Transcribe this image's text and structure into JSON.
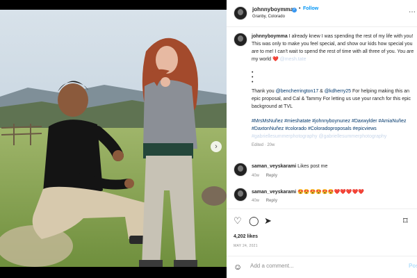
{
  "post": {
    "username": "johnnyboymma",
    "location": "Granby, Colorado",
    "follow_label": "Follow",
    "more_icon": "ellipsis-icon"
  },
  "caption": {
    "username": "johnnyboymma",
    "text_1": "I already knew I was spending the rest of my life with you! This was only to make you feel special, and show our kids how special you are to me! I can't wait to spend the rest of time with all three of you. You are my world ",
    "heart": "❤️",
    "mention_1": "@mesh.tate",
    "dots": [
      "•",
      "•",
      "•"
    ],
    "text_2": "Thank you ",
    "mention_2": "@bencherrington17",
    "amp": " & ",
    "mention_3": "@kdherry25",
    "text_3": " For helping making this an epic proposal, and Cal & Tammy For letting us use your ranch for this epic background at TVL",
    "hashtags_1": "#MrsMsNuñez #mieshatate #johnnyboynunez #Daxwylder #AmiaNuñez #DaxtonNuñez #colorado #Coloradoproposals #epicviews",
    "hashtags_2": "#gabriellesummerphotography @gabriellesummerphotography",
    "time_ago": "Edited · 20w"
  },
  "comments": [
    {
      "username": "saman_veyskarami",
      "text": "Likes post me",
      "time": "40w",
      "reply_label": "Reply"
    },
    {
      "username": "saman_veyskarami",
      "text": "😍😍😍😍😍😍❤️❤️❤️❤️❤️",
      "time": "40w",
      "reply_label": "Reply"
    }
  ],
  "actions": {
    "like_icon": "heart-icon",
    "comment_icon": "comment-icon",
    "share_icon": "share-icon",
    "save_icon": "bookmark-icon"
  },
  "likes": "4,202 likes",
  "date": "MAY 24, 2021",
  "add_comment": {
    "placeholder": "Add a comment...",
    "post_label": "Post"
  },
  "colors": {
    "accent": "#0095f6",
    "link": "#00376b",
    "text": "#262626",
    "muted": "#8e8e8e"
  }
}
